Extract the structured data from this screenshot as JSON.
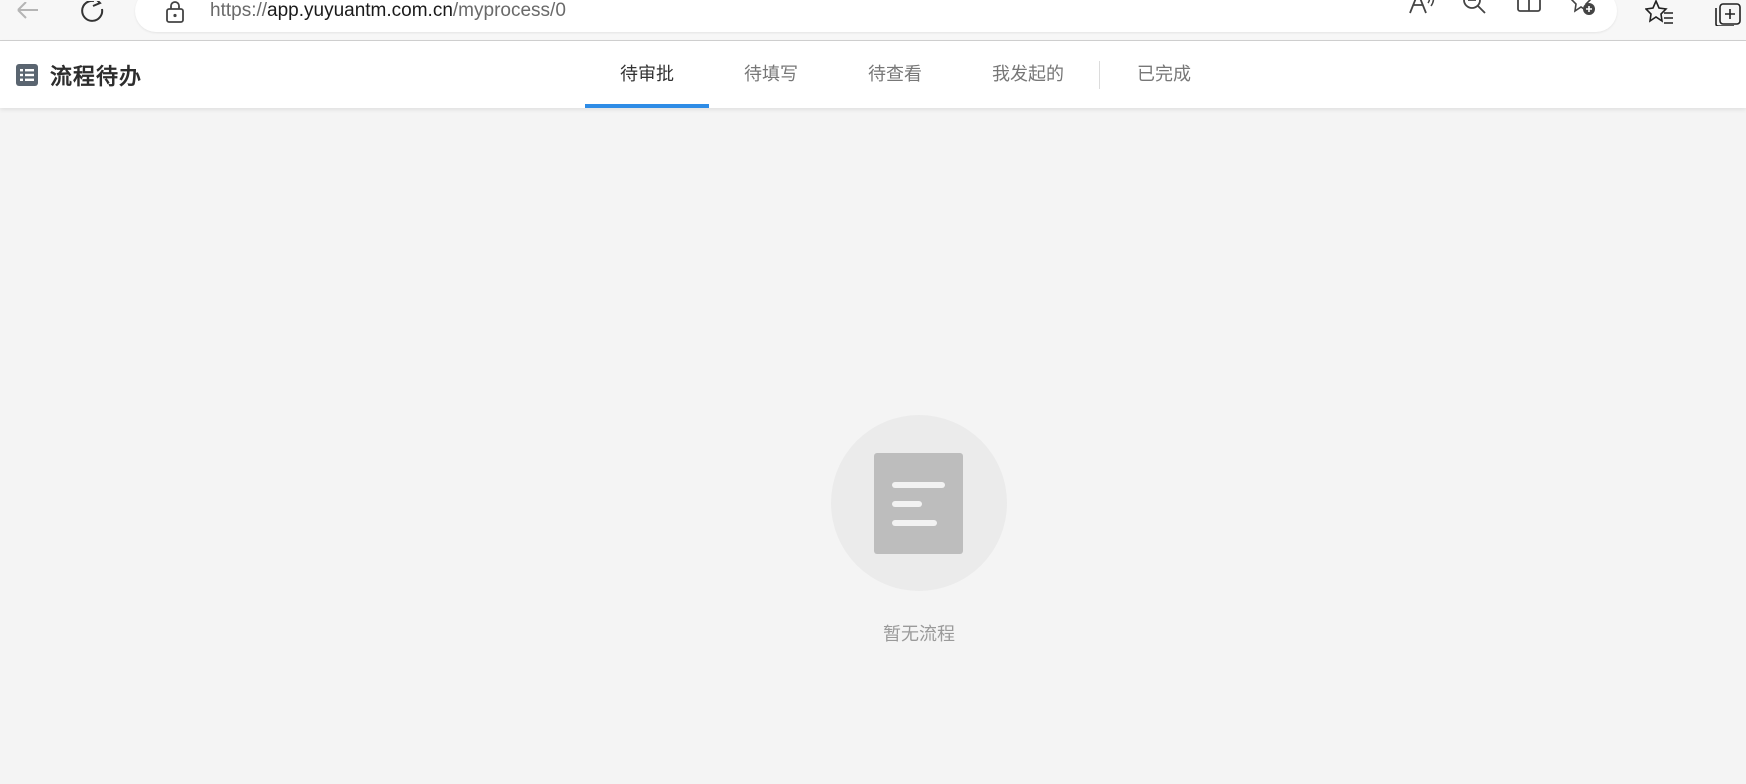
{
  "browser": {
    "url_scheme": "https://",
    "url_host": "app.yuyuantm.com.cn",
    "url_path": "/myprocess/0"
  },
  "header": {
    "title": "流程待办",
    "title_icon": "list-icon"
  },
  "tabs": [
    {
      "label": "待审批",
      "active": true
    },
    {
      "label": "待填写",
      "active": false
    },
    {
      "label": "待查看",
      "active": false
    },
    {
      "label": "我发起的",
      "active": false
    },
    {
      "label": "已完成",
      "active": false
    }
  ],
  "empty_state": {
    "icon": "document-icon",
    "message": "暂无流程"
  },
  "colors": {
    "accent": "#2e8ce6",
    "background": "#f4f4f4",
    "tab_text": "#777777",
    "tab_active_text": "#333333"
  }
}
